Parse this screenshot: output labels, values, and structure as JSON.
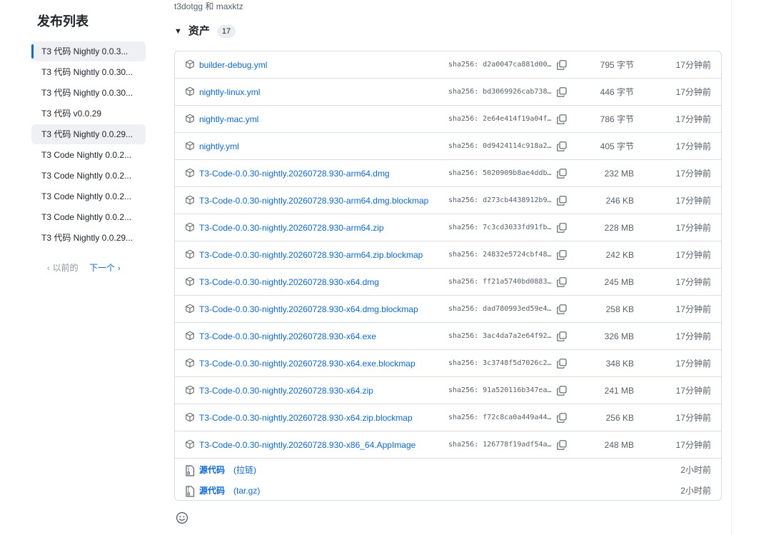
{
  "sidebar": {
    "title": "发布列表",
    "items": [
      {
        "label": "T3 代码 Nightly 0.0.3..."
      },
      {
        "label": "T3 代码 Nightly 0.0.30..."
      },
      {
        "label": "T3 代码 Nightly 0.0.30..."
      },
      {
        "label": "T3 代码 v0.0.29"
      },
      {
        "label": "T3 代码 Nightly 0.0.29..."
      },
      {
        "label": "T3 Code Nightly 0.0.2..."
      },
      {
        "label": "T3 Code Nightly 0.0.2..."
      },
      {
        "label": "T3 Code Nightly 0.0.2..."
      },
      {
        "label": "T3 Code Nightly 0.0.2..."
      },
      {
        "label": "T3 代码 Nightly 0.0.29..."
      }
    ],
    "pager": {
      "prev": "以前的",
      "next": "下一个"
    }
  },
  "main": {
    "authors": "t3dotgg 和 maxktz",
    "assets_title": "资产",
    "assets_count": "17",
    "assets": [
      {
        "name": "builder-debug.yml",
        "sha": "sha256: d2a0047ca881d005...",
        "size": "795 字节",
        "time": "17分钟前"
      },
      {
        "name": "nightly-linux.yml",
        "sha": "sha256: bd3069926cab7381...",
        "size": "446 字节",
        "time": "17分钟前"
      },
      {
        "name": "nightly-mac.yml",
        "sha": "sha256: 2e64e414f19a04fa...",
        "size": "786 字节",
        "time": "17分钟前"
      },
      {
        "name": "nightly.yml",
        "sha": "sha256: 0d9424114c918a23...",
        "size": "405 字节",
        "time": "17分钟前"
      },
      {
        "name": "T3-Code-0.0.30-nightly.20260728.930-arm64.dmg",
        "sha": "sha256: 5020909b8ae4ddb8...",
        "size": "232 MB",
        "time": "17分钟前"
      },
      {
        "name": "T3-Code-0.0.30-nightly.20260728.930-arm64.dmg.blockmap",
        "sha": "sha256: d273cb4438912b98...",
        "size": "246 KB",
        "time": "17分钟前"
      },
      {
        "name": "T3-Code-0.0.30-nightly.20260728.930-arm64.zip",
        "sha": "sha256: 7c3cd3033fd91fb9...",
        "size": "228 MB",
        "time": "17分钟前"
      },
      {
        "name": "T3-Code-0.0.30-nightly.20260728.930-arm64.zip.blockmap",
        "sha": "sha256: 24832e5724cbf482...",
        "size": "242 KB",
        "time": "17分钟前"
      },
      {
        "name": "T3-Code-0.0.30-nightly.20260728.930-x64.dmg",
        "sha": "sha256: ff21a5740bd08836...",
        "size": "245 MB",
        "time": "17分钟前"
      },
      {
        "name": "T3-Code-0.0.30-nightly.20260728.930-x64.dmg.blockmap",
        "sha": "sha256: dad780993ed59e49...",
        "size": "258 KB",
        "time": "17分钟前"
      },
      {
        "name": "T3-Code-0.0.30-nightly.20260728.930-x64.exe",
        "sha": "sha256: 3ac4da7a2e64f92f...",
        "size": "326 MB",
        "time": "17分钟前"
      },
      {
        "name": "T3-Code-0.0.30-nightly.20260728.930-x64.exe.blockmap",
        "sha": "sha256: 3c3748f5d7026c2b...",
        "size": "348 KB",
        "time": "17分钟前"
      },
      {
        "name": "T3-Code-0.0.30-nightly.20260728.930-x64.zip",
        "sha": "sha256: 91a520116b347ea1...",
        "size": "241 MB",
        "time": "17分钟前"
      },
      {
        "name": "T3-Code-0.0.30-nightly.20260728.930-x64.zip.blockmap",
        "sha": "sha256: f72c8ca0a449a44e...",
        "size": "256 KB",
        "time": "17分钟前"
      },
      {
        "name": "T3-Code-0.0.30-nightly.20260728.930-x86_64.AppImage",
        "sha": "sha256: 126778f19adf54ab...",
        "size": "248 MB",
        "time": "17分钟前"
      }
    ],
    "source": [
      {
        "name": "源代码",
        "format": "(拉链)",
        "time": "2小时前"
      },
      {
        "name": "源代码",
        "format": "(tar.gz)",
        "time": "2小时前"
      }
    ]
  },
  "colors": {
    "link": "#0969da",
    "muted": "#57606a",
    "border": "#d8dee4",
    "active_bar": "#0969da"
  },
  "icons": {
    "asset": "package-icon",
    "copy": "copy-icon",
    "source": "file-zip-icon",
    "reaction": "smiley-icon"
  }
}
